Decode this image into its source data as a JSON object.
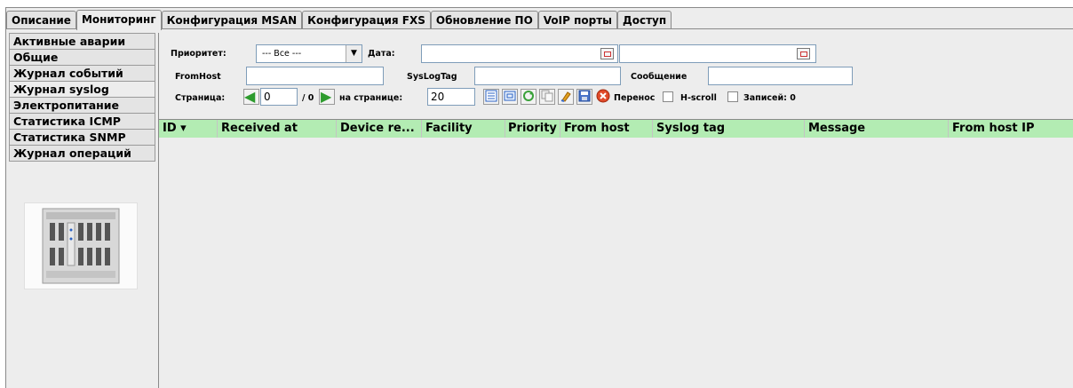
{
  "tabs": [
    {
      "label": "Описание"
    },
    {
      "label": "Мониторинг"
    },
    {
      "label": "Конфигурация MSAN"
    },
    {
      "label": "Конфигурация FXS"
    },
    {
      "label": "Обновление ПО"
    },
    {
      "label": "VoIP порты"
    },
    {
      "label": "Доступ"
    }
  ],
  "active_tab": "Мониторинг",
  "sidebar": {
    "items": [
      {
        "label": "Активные аварии"
      },
      {
        "label": "Общие"
      },
      {
        "label": "Журнал событий"
      },
      {
        "label": "Журнал syslog"
      },
      {
        "label": "Электропитание"
      },
      {
        "label": "Статистика ICMP"
      },
      {
        "label": "Статистика SNMP"
      },
      {
        "label": "Журнал операций"
      }
    ],
    "active": "Журнал syslog"
  },
  "filters": {
    "priority_label": "Приоритет:",
    "priority_value": "--- Все ---",
    "date_label": "Дата:",
    "date_from": "",
    "date_to": "",
    "fromhost_label": "FromHost",
    "fromhost_value": "",
    "syslogtag_label": "SysLogTag",
    "syslogtag_value": "",
    "message_label": "Сообщение",
    "message_value": "",
    "page_label": "Страница:",
    "page_value": "0",
    "page_total": "/ 0",
    "per_page_label": "на странице:",
    "per_page_value": "20",
    "wrap_label": "Перенос",
    "hscroll_label": "H-scroll",
    "records_label": "Записей: 0"
  },
  "toolbar_icons": [
    "columns-icon",
    "fit-icon",
    "refresh-icon",
    "copy-icon",
    "clear-filter-icon",
    "save-icon",
    "stop-icon"
  ],
  "table": {
    "columns": [
      {
        "label": "ID ▾"
      },
      {
        "label": "Received at"
      },
      {
        "label": "Device re..."
      },
      {
        "label": "Facility"
      },
      {
        "label": "Priority"
      },
      {
        "label": "From host"
      },
      {
        "label": "Syslog tag"
      },
      {
        "label": "Message"
      },
      {
        "label": "From host IP"
      }
    ],
    "rows": []
  },
  "colors": {
    "header_bg": "#b3ecb3",
    "panel_bg": "#ededed",
    "nav_arrow": "#2d9b2d"
  }
}
